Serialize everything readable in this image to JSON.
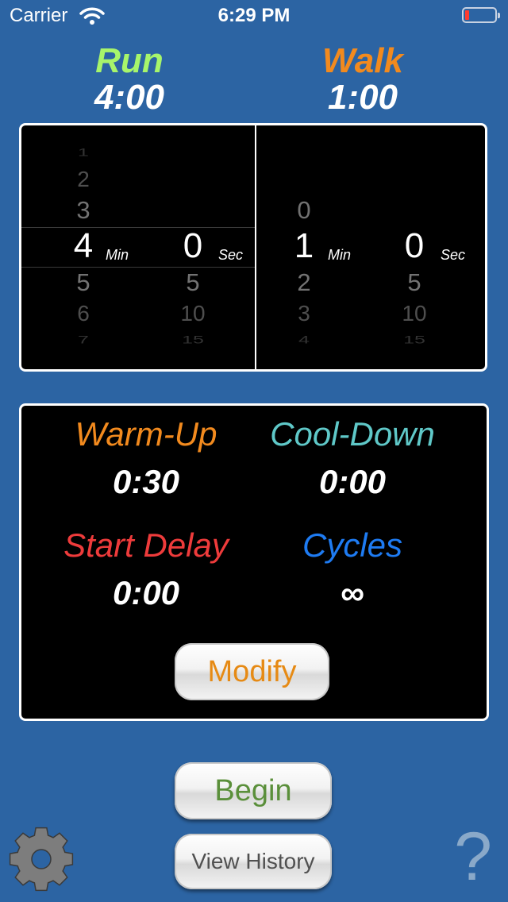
{
  "status_bar": {
    "carrier": "Carrier",
    "time": "6:29 PM"
  },
  "header": {
    "run_label": "Run",
    "run_time": "4:00",
    "walk_label": "Walk",
    "walk_time": "1:00",
    "run_color": "#a7f56b",
    "walk_color": "#f28a1e"
  },
  "pickers": {
    "run_minutes": [
      "1",
      "2",
      "3",
      "4",
      "5",
      "6",
      "7"
    ],
    "run_seconds": [
      "0",
      "5",
      "10",
      "15"
    ],
    "walk_minutes": [
      "0",
      "1",
      "2",
      "3",
      "4"
    ],
    "walk_seconds": [
      "0",
      "5",
      "10",
      "15"
    ],
    "min_unit": "Min",
    "sec_unit": "Sec"
  },
  "settings": {
    "warmup_label": "Warm-Up",
    "warmup_value": "0:30",
    "cooldown_label": "Cool-Down",
    "cooldown_value": "0:00",
    "start_delay_label": "Start Delay",
    "start_delay_value": "0:00",
    "cycles_label": "Cycles",
    "cycles_value": "∞",
    "warmup_color": "#f28a1e",
    "cooldown_color": "#5fc8c8",
    "start_delay_color": "#ee3b3b",
    "cycles_color": "#1e7bf2"
  },
  "buttons": {
    "modify": "Modify",
    "begin": "Begin",
    "view_history": "View History"
  },
  "icons": {
    "settings": "gear-icon",
    "help": "?"
  }
}
